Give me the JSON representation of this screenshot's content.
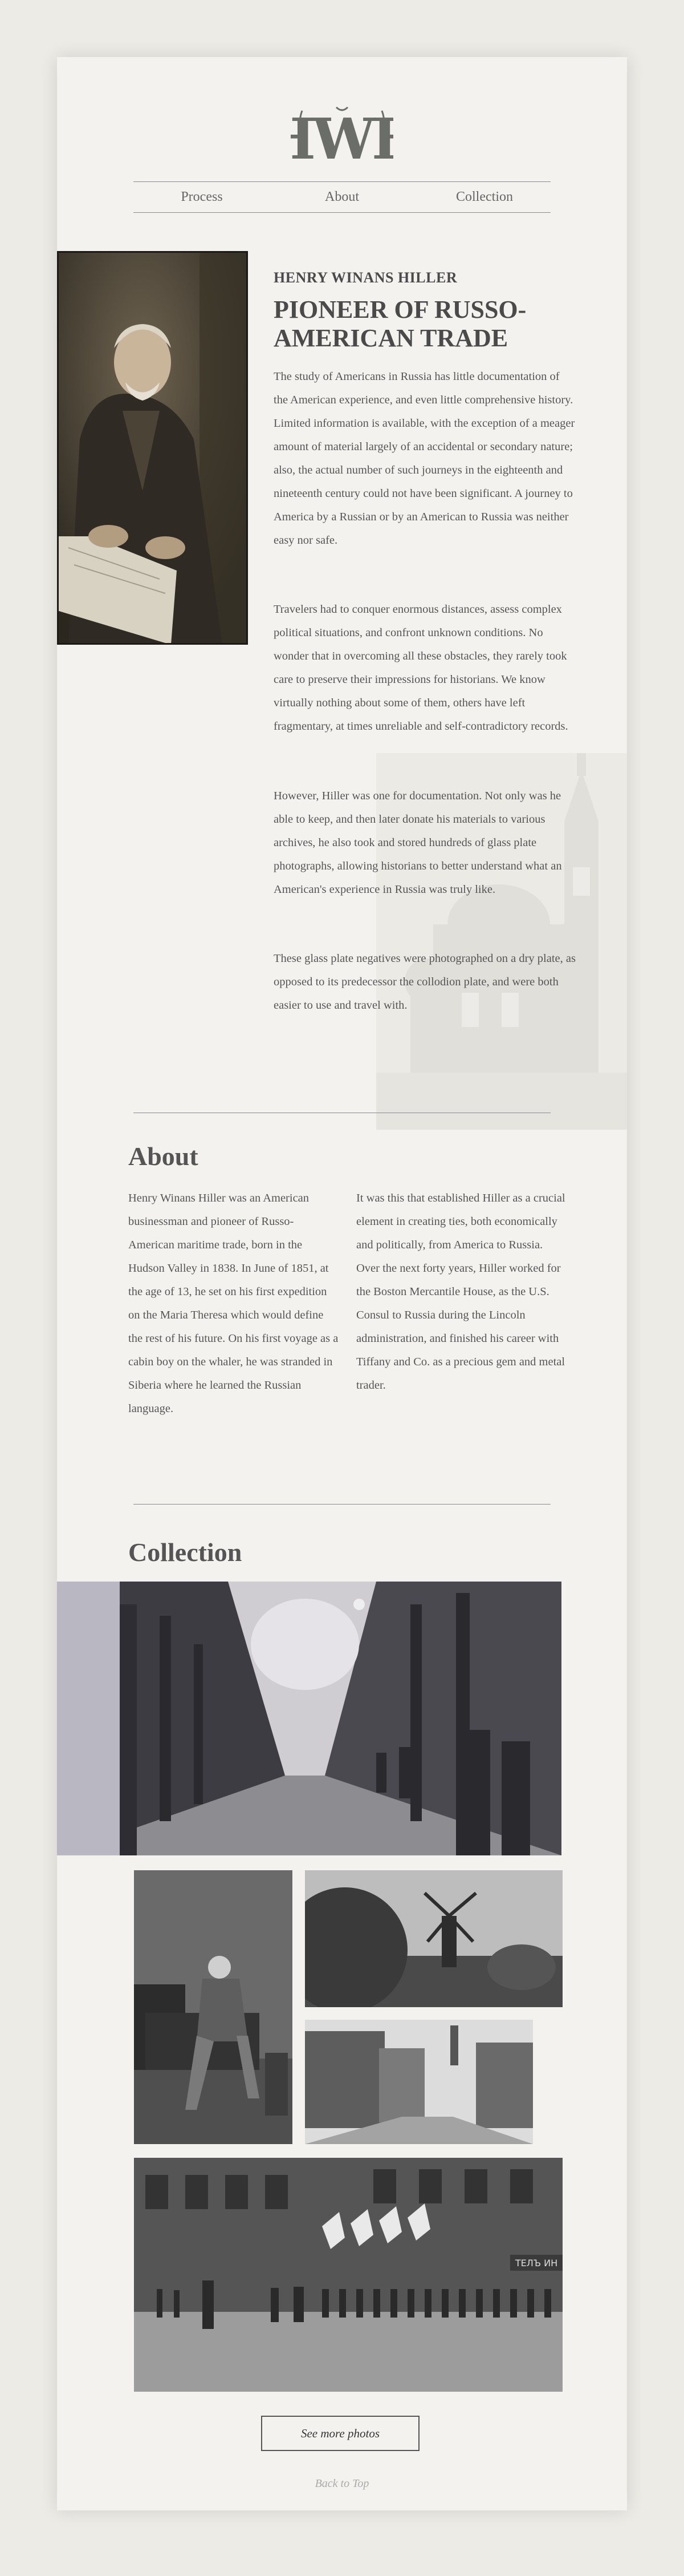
{
  "header": {
    "logo_text": "HWH",
    "nav": [
      "Process",
      "About",
      "Collection"
    ]
  },
  "hero": {
    "kicker": "HENRY WINANS HILLER",
    "title": "PIONEER OF RUSSO-AMERICAN TRADE",
    "paragraphs": [
      "The study of Americans in Russia has little documentation of the American experience, and even little comprehensive history. Limited information is available, with the exception of a meager amount of material largely of an accidental or secondary nature; also, the actual number of such journeys in the eighteenth and nineteenth century could not have been significant. A journey to America by a Russian or by an American to Russia was neither easy nor safe.",
      "Travelers had to conquer enormous distances, assess complex political situations, and confront unknown conditions. No wonder that in overcoming all these obstacles, they rarely took care to preserve their impressions for historians. We know virtually nothing about some of them, others have left fragmentary, at times unreliable and self-contradictory records.",
      "However, Hiller was one for documentation. Not only was he able to keep, and then later donate his materials to various archives, he also took and stored hundreds of glass plate photographs, allowing historians to better understand what an American's experience in Russia was truly like.",
      "These glass plate negatives were photographed on a dry plate, as opposed to its predecessor the collodion plate, and were both easier to use and travel with."
    ]
  },
  "about": {
    "title": "About",
    "col1": "Henry Winans Hiller was an American businessman and pioneer of Russo-American maritime trade, born in the Hudson Valley in 1838. In June of 1851, at the age of 13, he set on his first expedition on the Maria Theresa which would define the rest of his future. On his first voyage as a cabin boy on the whaler, he was stranded in Siberia where he learned the Russian language.",
    "col2": "It was this that established Hiller as a crucial element in creating ties, both economically and politically, from America to Russia. Over the next forty years, Hiller worked for the Boston Mercantile House, as the U.S. Consul to Russia during the Lincoln administration, and finished his career with Tiffany and Co. as a precious gem and metal trader."
  },
  "collection": {
    "title": "Collection",
    "more_label": "See more photos",
    "sign_text": "ТЕЛЪ ИН"
  },
  "footer": {
    "back_to_top": "Back to Top"
  }
}
